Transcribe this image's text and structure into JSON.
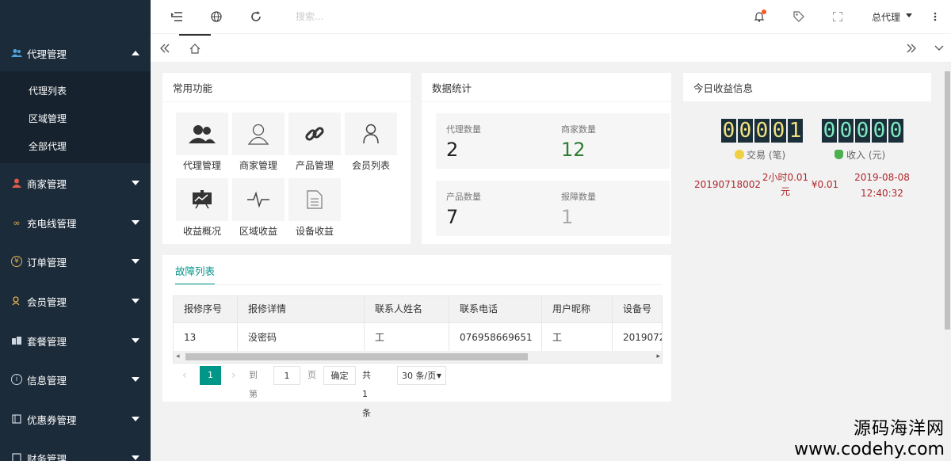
{
  "sidebar": {
    "groups": [
      {
        "label": "代理管理",
        "icon": "users-icon",
        "expanded": true
      },
      {
        "label": "商家管理",
        "icon": "user-icon"
      },
      {
        "label": "充电线管理",
        "icon": "infinity-icon"
      },
      {
        "label": "订单管理",
        "icon": "yen-icon"
      },
      {
        "label": "会员管理",
        "icon": "member-icon"
      },
      {
        "label": "套餐管理",
        "icon": "package-icon"
      },
      {
        "label": "信息管理",
        "icon": "info-icon"
      },
      {
        "label": "优惠券管理",
        "icon": "coupon-icon"
      },
      {
        "label": "财务管理",
        "icon": "finance-icon"
      }
    ],
    "sub_items": [
      "代理列表",
      "区域管理",
      "全部代理"
    ]
  },
  "topbar": {
    "search_placeholder": "搜索...",
    "user_name": "总代理"
  },
  "quick_functions": {
    "title": "常用功能",
    "items": [
      {
        "label": "代理管理",
        "icon": "users-icon"
      },
      {
        "label": "商家管理",
        "icon": "user-outline-icon"
      },
      {
        "label": "产品管理",
        "icon": "link-icon"
      },
      {
        "label": "会员列表",
        "icon": "person-icon"
      },
      {
        "label": "收益概况",
        "icon": "chart-board-icon"
      },
      {
        "label": "区域收益",
        "icon": "pulse-icon"
      },
      {
        "label": "设备收益",
        "icon": "document-icon"
      }
    ]
  },
  "stats": {
    "title": "数据统计",
    "items": [
      {
        "label": "代理数量",
        "value": "2",
        "color": "#222222"
      },
      {
        "label": "商家数量",
        "value": "12",
        "color": "#2e7d32"
      },
      {
        "label": "产品数量",
        "value": "7",
        "color": "#222222"
      },
      {
        "label": "报障数量",
        "value": "1",
        "color": "#aaaaaa"
      }
    ]
  },
  "revenue": {
    "title": "今日收益信息",
    "trades_digits": [
      "0",
      "0",
      "0",
      "0",
      "1"
    ],
    "income_digits": [
      "0",
      "0",
      "0",
      "0",
      "0"
    ],
    "trades_label": "交易 (笔)",
    "income_label": "收入 (元)",
    "record": {
      "order_no": "20190718002",
      "package_line1": "2小时0.01",
      "package_line2": "元",
      "amount": "¥0.01",
      "date": "2019-08-08",
      "time": "12:40:32"
    }
  },
  "faults": {
    "tab": "故障列表",
    "columns": [
      "报修序号",
      "报修详情",
      "联系人姓名",
      "联系电话",
      "用户昵称",
      "设备号"
    ],
    "rows": [
      [
        "13",
        "没密码",
        "工",
        "076958669651",
        "工",
        "2019072"
      ]
    ],
    "pager": {
      "current_page": "1",
      "goto_label": "到第",
      "goto_value": "1",
      "page_unit": "页",
      "confirm": "确定",
      "total": "共 1 条",
      "page_size": "30 条/页"
    }
  },
  "watermark": {
    "line1": "源码海洋网",
    "line2": "www.codehy.com"
  },
  "colors": {
    "sidebar_bg": "#1c2b3a",
    "accent": "#009688",
    "revenue_red": "#b0272b"
  }
}
